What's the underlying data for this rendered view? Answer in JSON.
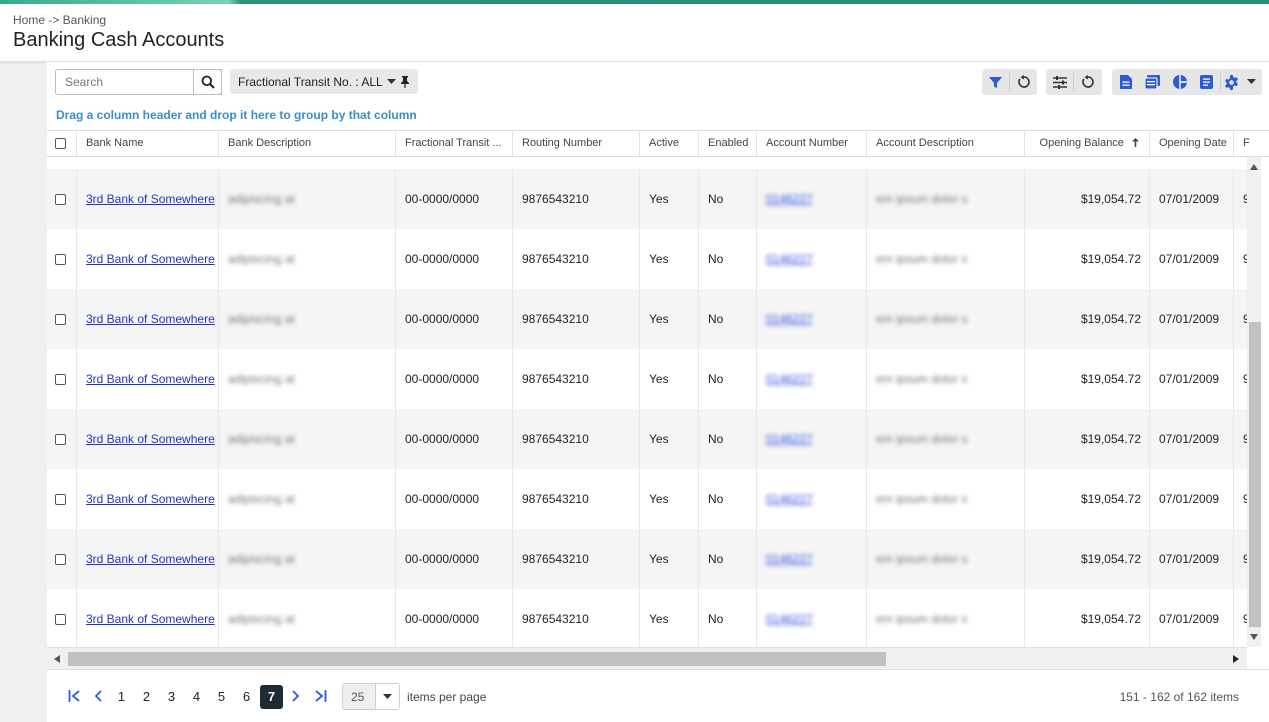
{
  "breadcrumb": "Home -> Banking",
  "page_title": "Banking Cash Accounts",
  "search": {
    "placeholder": "Search",
    "value": ""
  },
  "filter_chip": {
    "label": "Fractional Transit No. : ALL"
  },
  "group_hint": "Drag a column header and drop it here to group by that column",
  "columns": [
    {
      "key": "select",
      "label": ""
    },
    {
      "key": "bank_name",
      "label": "Bank Name"
    },
    {
      "key": "bank_description",
      "label": "Bank Description"
    },
    {
      "key": "fractional_transit",
      "label": "Fractional Transit ..."
    },
    {
      "key": "routing_number",
      "label": "Routing Number"
    },
    {
      "key": "active",
      "label": "Active"
    },
    {
      "key": "enabled",
      "label": "Enabled"
    },
    {
      "key": "account_number",
      "label": "Account Number"
    },
    {
      "key": "account_description",
      "label": "Account Description"
    },
    {
      "key": "opening_balance",
      "label": "Opening Balance",
      "sort": "ascending"
    },
    {
      "key": "opening_date",
      "label": "Opening Date"
    },
    {
      "key": "next",
      "label": "F"
    }
  ],
  "rows": [
    {
      "bank_name": "3rd Bank of Somewhere",
      "bank_description": "adipiscing at",
      "fractional_transit": "00-0000/0000",
      "routing_number": "9876543210",
      "active": "Yes",
      "enabled": "No",
      "account_number": "0146227",
      "account_description": "em ipsum dolor s",
      "opening_balance": "$19,054.72",
      "opening_date": "07/01/2009",
      "next": "9"
    },
    {
      "bank_name": "3rd Bank of Somewhere",
      "bank_description": "adipiscing at",
      "fractional_transit": "00-0000/0000",
      "routing_number": "9876543210",
      "active": "Yes",
      "enabled": "No",
      "account_number": "0146227",
      "account_description": "em ipsum dolor s",
      "opening_balance": "$19,054.72",
      "opening_date": "07/01/2009",
      "next": "9"
    },
    {
      "bank_name": "3rd Bank of Somewhere",
      "bank_description": "adipiscing at",
      "fractional_transit": "00-0000/0000",
      "routing_number": "9876543210",
      "active": "Yes",
      "enabled": "No",
      "account_number": "0146227",
      "account_description": "em ipsum dolor s",
      "opening_balance": "$19,054.72",
      "opening_date": "07/01/2009",
      "next": "9"
    },
    {
      "bank_name": "3rd Bank of Somewhere",
      "bank_description": "adipiscing at",
      "fractional_transit": "00-0000/0000",
      "routing_number": "9876543210",
      "active": "Yes",
      "enabled": "No",
      "account_number": "0146227",
      "account_description": "em ipsum dolor s",
      "opening_balance": "$19,054.72",
      "opening_date": "07/01/2009",
      "next": "9"
    },
    {
      "bank_name": "3rd Bank of Somewhere",
      "bank_description": "adipiscing at",
      "fractional_transit": "00-0000/0000",
      "routing_number": "9876543210",
      "active": "Yes",
      "enabled": "No",
      "account_number": "0146227",
      "account_description": "em ipsum dolor s",
      "opening_balance": "$19,054.72",
      "opening_date": "07/01/2009",
      "next": "9"
    },
    {
      "bank_name": "3rd Bank of Somewhere",
      "bank_description": "adipiscing at",
      "fractional_transit": "00-0000/0000",
      "routing_number": "9876543210",
      "active": "Yes",
      "enabled": "No",
      "account_number": "0146227",
      "account_description": "em ipsum dolor s",
      "opening_balance": "$19,054.72",
      "opening_date": "07/01/2009",
      "next": "9"
    },
    {
      "bank_name": "3rd Bank of Somewhere",
      "bank_description": "adipiscing at",
      "fractional_transit": "00-0000/0000",
      "routing_number": "9876543210",
      "active": "Yes",
      "enabled": "No",
      "account_number": "0146227",
      "account_description": "em ipsum dolor s",
      "opening_balance": "$19,054.72",
      "opening_date": "07/01/2009",
      "next": "9"
    },
    {
      "bank_name": "3rd Bank of Somewhere",
      "bank_description": "adipiscing at",
      "fractional_transit": "00-0000/0000",
      "routing_number": "9876543210",
      "active": "Yes",
      "enabled": "No",
      "account_number": "0146227",
      "account_description": "em ipsum dolor s",
      "opening_balance": "$19,054.72",
      "opening_date": "07/01/2009",
      "next": "9"
    }
  ],
  "pager": {
    "pages": [
      "1",
      "2",
      "3",
      "4",
      "5",
      "6",
      "7"
    ],
    "current_page": "7",
    "per_page": "25",
    "per_page_label": "items per page",
    "info": "151 - 162 of 162 items"
  },
  "colors": {
    "accent": "#2d8a79",
    "link": "#2233cc",
    "primary_icon": "#2c5bd6",
    "hint": "#3b8ec4",
    "active_page": "#1d2b36"
  },
  "icons": [
    "search-icon",
    "pin-icon",
    "filter-icon",
    "reset-icon",
    "column-settings-icon",
    "reset-columns-icon",
    "excel-export-icon",
    "pdf-export-icon",
    "chart-icon",
    "report-icon",
    "gear-icon",
    "chevron-down-icon"
  ]
}
